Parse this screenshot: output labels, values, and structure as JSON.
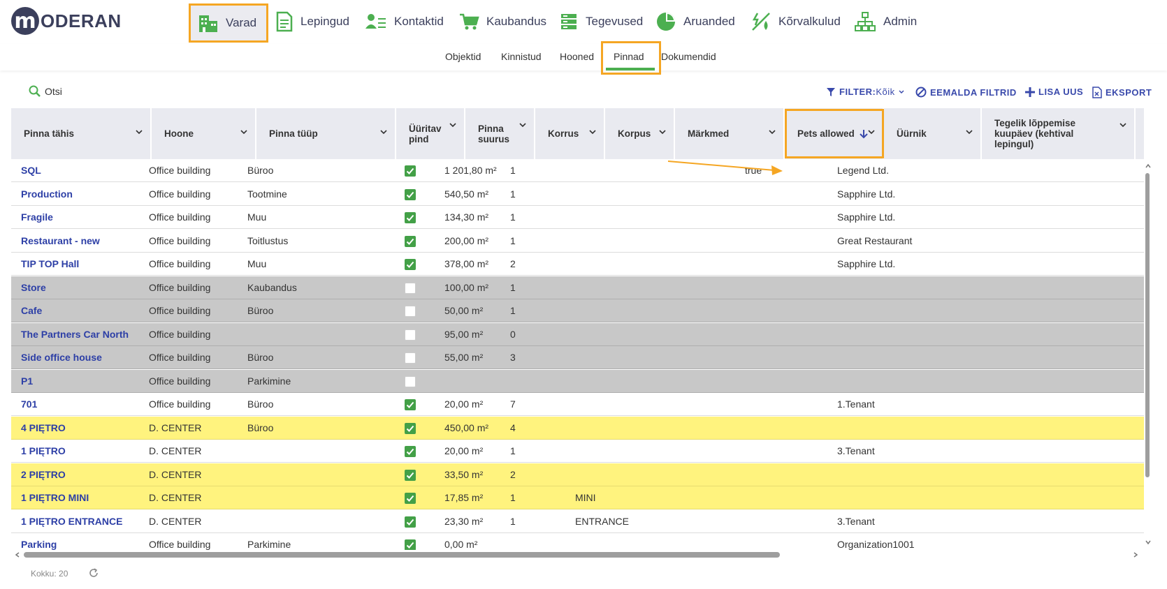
{
  "brand": {
    "logo_letter": "m",
    "logo_text": "ODERAN"
  },
  "nav": {
    "items": [
      {
        "label": "Varad",
        "icon": "building-icon"
      },
      {
        "label": "Lepingud",
        "icon": "document-icon"
      },
      {
        "label": "Kontaktid",
        "icon": "contacts-icon"
      },
      {
        "label": "Kaubandus",
        "icon": "cart-icon"
      },
      {
        "label": "Tegevused",
        "icon": "tasks-icon"
      },
      {
        "label": "Aruanded",
        "icon": "pie-chart-icon"
      },
      {
        "label": "Kõrvalkulud",
        "icon": "utilities-icon"
      },
      {
        "label": "Admin",
        "icon": "org-chart-icon"
      }
    ],
    "active": "Varad"
  },
  "subnav": {
    "items": [
      "Objektid",
      "Kinnistud",
      "Hooned",
      "Pinnad",
      "Dokumendid"
    ],
    "active": "Pinnad"
  },
  "toolbar": {
    "search_label": "Otsi",
    "filter_label": "FILTER:",
    "filter_value": "Kõik",
    "clear_filters_label": "EEMALDA FILTRID",
    "add_new_label": "LISA UUS",
    "export_label": "EKSPORT"
  },
  "table": {
    "columns": [
      "Pinna tähis",
      "Hoone",
      "Pinna tüüp",
      "Üüritav pind",
      "Pinna suurus",
      "Korrus",
      "Korpus",
      "Märkmed",
      "Pets allowed",
      "Üürnik",
      "Tegelik lõppemise kuupäev (kehtival lepingul)"
    ],
    "rows": [
      {
        "name": "SQL",
        "building": "Office building",
        "type": "Büroo",
        "rentable": true,
        "size": "1 201,80 m²",
        "floor": "1",
        "korpus": "",
        "notes": "",
        "pets": "true",
        "tenant": "Legend Ltd.",
        "end_date": "",
        "style": "normal"
      },
      {
        "name": "Production",
        "building": "Office building",
        "type": "Tootmine",
        "rentable": true,
        "size": "540,50 m²",
        "floor": "1",
        "korpus": "",
        "notes": "",
        "pets": "",
        "tenant": "Sapphire Ltd.",
        "end_date": "",
        "style": "normal"
      },
      {
        "name": "Fragile",
        "building": "Office building",
        "type": "Muu",
        "rentable": true,
        "size": "134,30 m²",
        "floor": "1",
        "korpus": "",
        "notes": "",
        "pets": "",
        "tenant": "Sapphire Ltd.",
        "end_date": "",
        "style": "normal"
      },
      {
        "name": "Restaurant - new",
        "building": "Office building",
        "type": "Toitlustus",
        "rentable": true,
        "size": "200,00 m²",
        "floor": "1",
        "korpus": "",
        "notes": "",
        "pets": "",
        "tenant": "Great Restaurant",
        "end_date": "",
        "style": "normal"
      },
      {
        "name": "TIP TOP Hall",
        "building": "Office building",
        "type": "Muu",
        "rentable": true,
        "size": "378,00 m²",
        "floor": "2",
        "korpus": "",
        "notes": "",
        "pets": "",
        "tenant": "Sapphire Ltd.",
        "end_date": "",
        "style": "normal"
      },
      {
        "name": "Store",
        "building": "Office building",
        "type": "Kaubandus",
        "rentable": false,
        "size": "100,00 m²",
        "floor": "1",
        "korpus": "",
        "notes": "",
        "pets": "",
        "tenant": "",
        "end_date": "",
        "style": "grey"
      },
      {
        "name": "Cafe",
        "building": "Office building",
        "type": "Büroo",
        "rentable": false,
        "size": "50,00 m²",
        "floor": "1",
        "korpus": "",
        "notes": "",
        "pets": "",
        "tenant": "",
        "end_date": "",
        "style": "grey"
      },
      {
        "name": "The Partners Car North",
        "building": "Office building",
        "type": "",
        "rentable": false,
        "size": "95,00 m²",
        "floor": "0",
        "korpus": "",
        "notes": "",
        "pets": "",
        "tenant": "",
        "end_date": "",
        "style": "grey"
      },
      {
        "name": "Side office house",
        "building": "Office building",
        "type": "Büroo",
        "rentable": false,
        "size": "55,00 m²",
        "floor": "3",
        "korpus": "",
        "notes": "",
        "pets": "",
        "tenant": "",
        "end_date": "",
        "style": "grey"
      },
      {
        "name": "P1",
        "building": "Office building",
        "type": "Parkimine",
        "rentable": false,
        "size": "",
        "floor": "",
        "korpus": "",
        "notes": "",
        "pets": "",
        "tenant": "",
        "end_date": "",
        "style": "grey"
      },
      {
        "name": "701",
        "building": "Office building",
        "type": "Büroo",
        "rentable": true,
        "size": "20,00 m²",
        "floor": "7",
        "korpus": "",
        "notes": "",
        "pets": "",
        "tenant": "1.Tenant",
        "end_date": "",
        "style": "normal"
      },
      {
        "name": "4 PIĘTRO",
        "building": "D. CENTER",
        "type": "Büroo",
        "rentable": true,
        "size": "450,00 m²",
        "floor": "4",
        "korpus": "",
        "notes": "",
        "pets": "",
        "tenant": "",
        "end_date": "",
        "style": "yellow"
      },
      {
        "name": "1 PIĘTRO",
        "building": "D. CENTER",
        "type": "",
        "rentable": true,
        "size": "20,00 m²",
        "floor": "1",
        "korpus": "",
        "notes": "",
        "pets": "",
        "tenant": "3.Tenant",
        "end_date": "",
        "style": "normal"
      },
      {
        "name": "2 PIĘTRO",
        "building": "D. CENTER",
        "type": "",
        "rentable": true,
        "size": "33,50 m²",
        "floor": "2",
        "korpus": "",
        "notes": "",
        "pets": "",
        "tenant": "",
        "end_date": "",
        "style": "yellow"
      },
      {
        "name": "1 PIĘTRO MINI",
        "building": "D. CENTER",
        "type": "",
        "rentable": true,
        "size": "17,85 m²",
        "floor": "1",
        "korpus": "MINI",
        "notes": "",
        "pets": "",
        "tenant": "",
        "end_date": "",
        "style": "yellow"
      },
      {
        "name": "1 PIĘTRO ENTRANCE",
        "building": "D. CENTER",
        "type": "",
        "rentable": true,
        "size": "23,30 m²",
        "floor": "1",
        "korpus": "ENTRANCE",
        "notes": "",
        "pets": "",
        "tenant": "3.Tenant",
        "end_date": "",
        "style": "normal"
      },
      {
        "name": "Parking",
        "building": "Office building",
        "type": "Parkimine",
        "rentable": true,
        "size": "0,00 m²",
        "floor": "",
        "korpus": "",
        "notes": "",
        "pets": "",
        "tenant": "Organization1001",
        "end_date": "",
        "style": "normal"
      }
    ]
  },
  "footer": {
    "total_label": "Kokku: 20"
  },
  "colors": {
    "accent_green": "#4caf50",
    "link_blue": "#2d3fa6",
    "highlight_orange": "#f5a623",
    "row_grey": "#c8c8c8",
    "row_yellow": "#fff37e"
  }
}
